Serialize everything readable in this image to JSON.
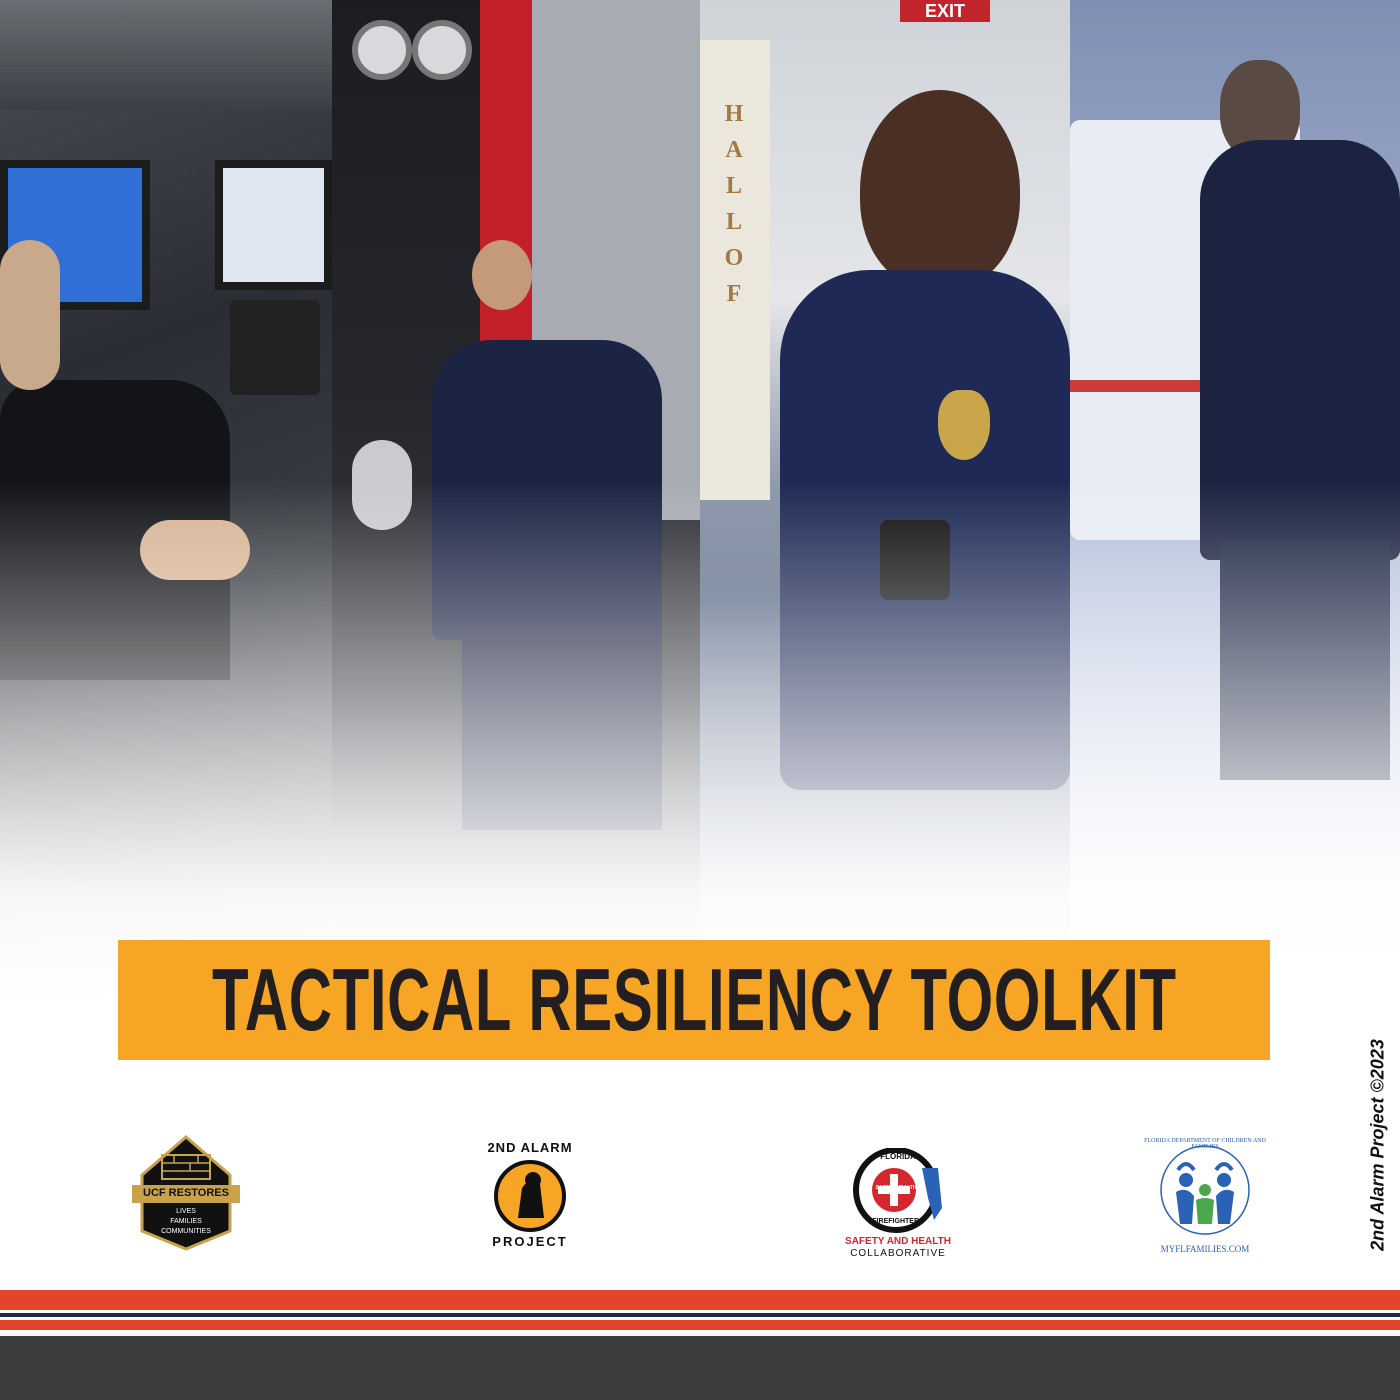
{
  "title": "TACTICAL RESILIENCY TOOLKIT",
  "copyright": "2nd Alarm Project ©2023",
  "photos": {
    "panel_4_exit_sign": "EXIT",
    "hall_of_sign": [
      "H",
      "A",
      "L",
      "L",
      "O",
      "F"
    ]
  },
  "logos": {
    "ucf": {
      "name": "UCF RESTORES",
      "tag": [
        "LIVES",
        "FAMILIES",
        "COMMUNITIES"
      ]
    },
    "alarm": {
      "top": "2ND ALARM",
      "bottom": "PROJECT"
    },
    "firefighters": {
      "ring_top": "FLORIDA",
      "ring_bottom": "FIREFIGHTERS",
      "center": "SAFETY HEALTH",
      "line1": "SAFETY AND HEALTH",
      "line2": "COLLABORATIVE"
    },
    "dcf": {
      "ring": "FLORIDA DEPARTMENT OF CHILDREN AND FAMILIES",
      "url": "MYFLFAMILIES.COM"
    }
  },
  "colors": {
    "banner": "#f6a524",
    "stripe_red": "#e2452a",
    "stripe_navy": "#1f2b4a",
    "footer": "#3d3d3d"
  }
}
